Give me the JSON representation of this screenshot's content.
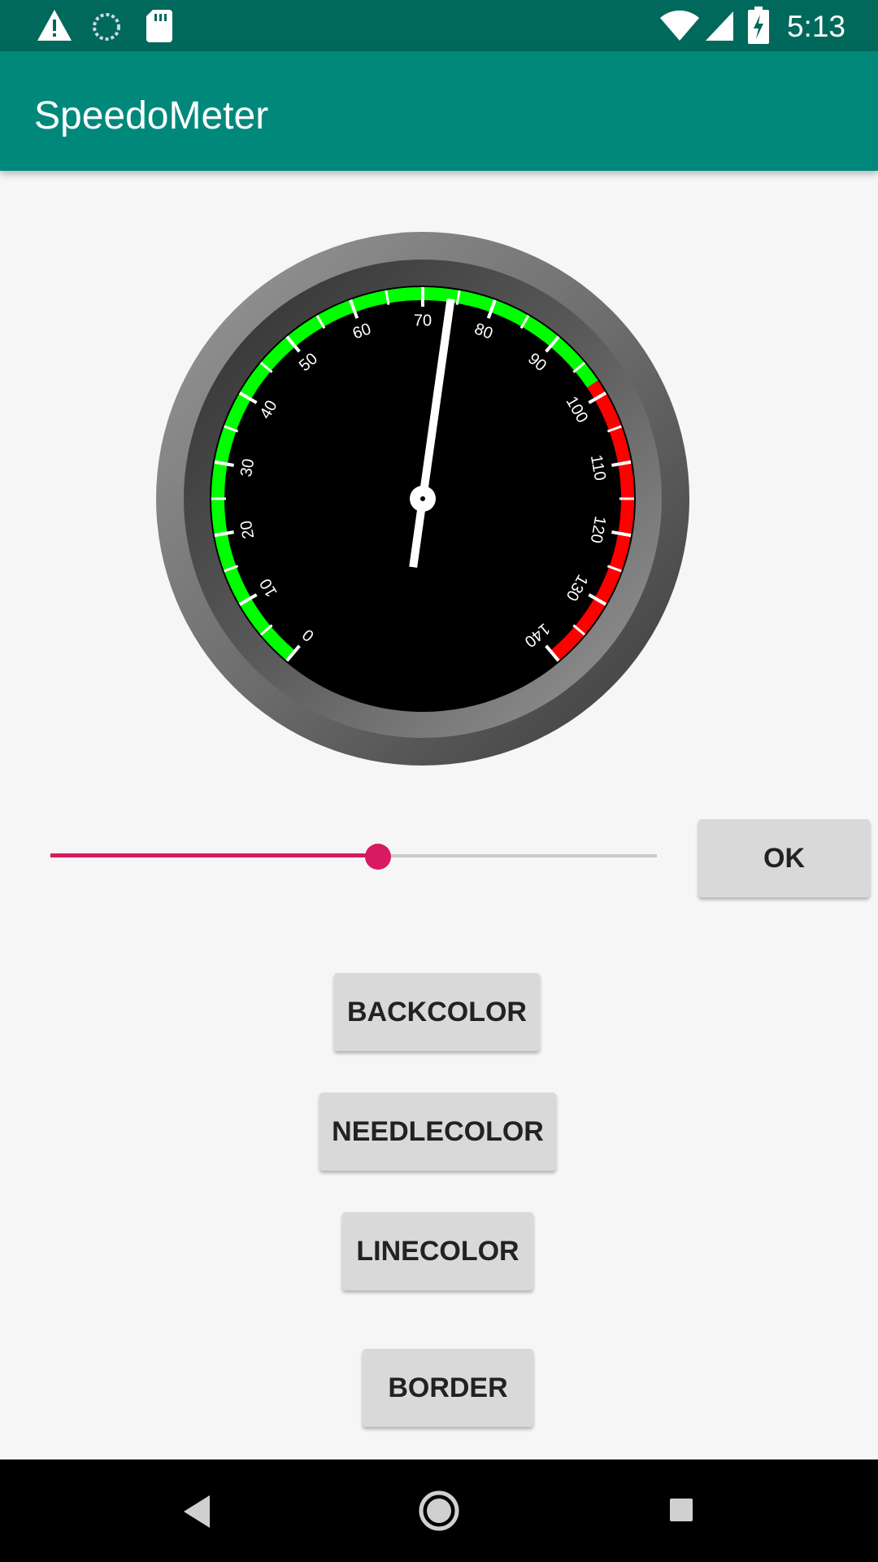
{
  "status_bar": {
    "time": "5:13",
    "icons": [
      "warning-icon",
      "sync-icon",
      "sd-card-icon",
      "wifi-icon",
      "signal-icon",
      "battery-charging-icon"
    ]
  },
  "app_bar": {
    "title": "SpeedoMeter"
  },
  "speedometer": {
    "tick_labels": [
      "0",
      "10",
      "20",
      "30",
      "40",
      "50",
      "60",
      "70",
      "80",
      "90",
      "100",
      "110",
      "120",
      "130",
      "140"
    ],
    "min": 0,
    "max": 140,
    "needle_value": 74,
    "red_zone_start": 98,
    "colors": {
      "face": "#000000",
      "safe_arc": "#00ff00",
      "danger_arc": "#ff0000",
      "needle": "#ffffff",
      "tick": "#ffffff",
      "bezel": "#8a8a8a"
    }
  },
  "seekbar": {
    "value_fraction": 0.54,
    "accent": "#d81b60"
  },
  "buttons": {
    "ok": "OK",
    "backcolor": "BACKCOLOR",
    "needlecolor": "NEEDLECOLOR",
    "linecolor": "LINECOLOR",
    "border": "BORDER"
  },
  "nav_bar": {
    "icons": [
      "back-icon",
      "home-icon",
      "recents-icon"
    ]
  }
}
